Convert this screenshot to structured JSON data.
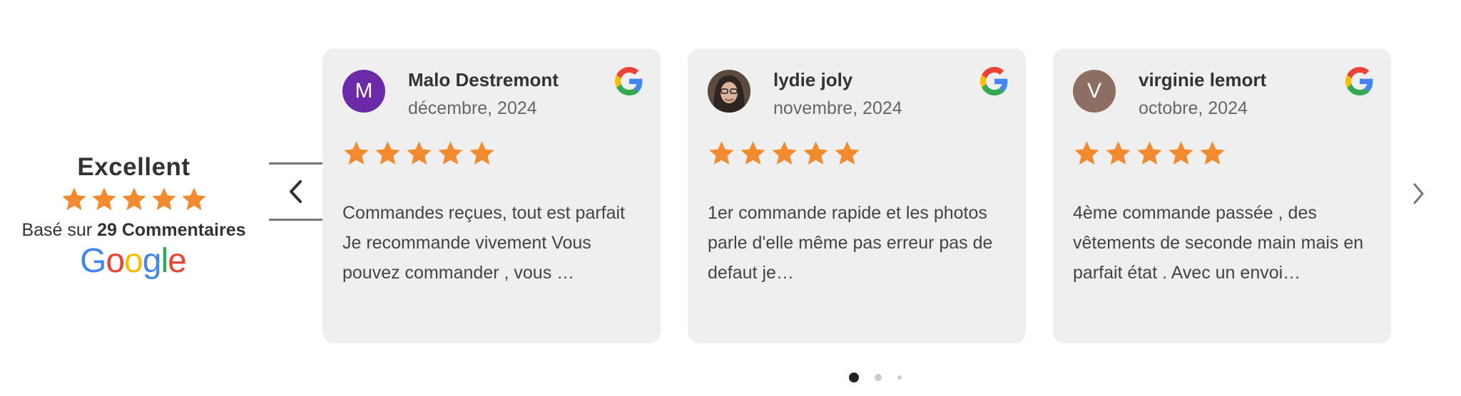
{
  "summary": {
    "rating_label": "Excellent",
    "based_prefix": "Basé sur",
    "based_count": "29 Commentaires",
    "stars": 5,
    "star_color": "#f28b30"
  },
  "reviews": [
    {
      "name": "Malo Destremont",
      "date": "décembre, 2024",
      "initial": "M",
      "avatar_color": "#6c2aa8",
      "stars": 5,
      "text": "Commandes reçues, tout est parfait Je recommande vivement Vous pouvez commander , vous …"
    },
    {
      "name": "lydie joly",
      "date": "novembre, 2024",
      "initial": "",
      "avatar_color": "#4a3b33",
      "stars": 5,
      "text": "1er commande rapide et les photos parle d'elle même pas erreur pas de defaut je…"
    },
    {
      "name": "virginie lemort",
      "date": "octobre, 2024",
      "initial": "V",
      "avatar_color": "#8d6e63",
      "stars": 5,
      "text": "4ème commande passée , des vêtements de seconde main mais en parfait état . Avec un envoi…"
    }
  ],
  "pagination": {
    "current": 1,
    "total": 3
  }
}
